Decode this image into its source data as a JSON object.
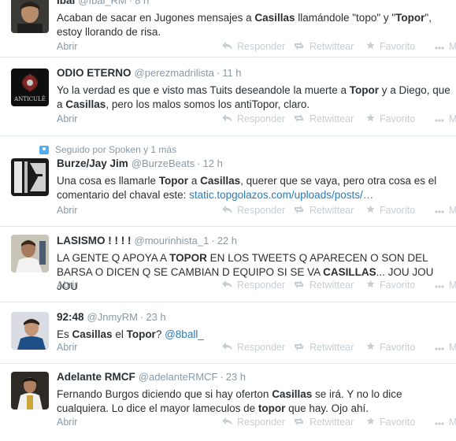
{
  "tweets": [
    {
      "fullname": "Ibai",
      "username": "@Ibai_RM",
      "time": "8 h",
      "text_parts": [
        {
          "t": "Acaban de sacar en Jugones mensajes a ",
          "b": false
        },
        {
          "t": "Casillas",
          "b": true
        },
        {
          "t": " llamándole \"topo\" y \"",
          "b": false
        },
        {
          "t": "Topor",
          "b": true
        },
        {
          "t": "\", estoy llorando de risa.",
          "b": false
        }
      ]
    },
    {
      "fullname": "ODIO ETERNO",
      "username": "@perezmadrilista",
      "time": "11 h",
      "avatar_caption": "ANTICULÉ",
      "text_parts": [
        {
          "t": "Yo la verdad es que e visto mas Tuits deseandole la muerte a ",
          "b": false
        },
        {
          "t": "Topor",
          "b": true
        },
        {
          "t": " y a Diego, que a ",
          "b": false
        },
        {
          "t": "Casillas",
          "b": true
        },
        {
          "t": ", pero los malos somos los antiTopor, claro.",
          "b": false
        }
      ]
    },
    {
      "context": "Seguido por Spoken y 1 más",
      "fullname": "Burze/Jay Jim",
      "username": "@BurzeBeats",
      "time": "12 h",
      "text_parts": [
        {
          "t": "Una cosa es llamarle ",
          "b": false
        },
        {
          "t": "Topor",
          "b": true
        },
        {
          "t": " a ",
          "b": false
        },
        {
          "t": "Casillas",
          "b": true
        },
        {
          "t": ", querer que se vaya, pero otra cosa es el comentario del chaval este: ",
          "b": false
        },
        {
          "t": "static.topgolazos.com/uploads/posts/…",
          "link": true
        }
      ]
    },
    {
      "fullname": "LASISMO ! ! ! !",
      "username": "@mourinhista_1",
      "time": "22 h",
      "text_parts": [
        {
          "t": "LA GENTE Q APOYA A ",
          "b": false
        },
        {
          "t": "TOPOR",
          "b": true
        },
        {
          "t": " EN LOS TWEETS Q APARECEN O SON DEL BARSA O DICEN Q SE CAMBIAN D EQUIPO SI SE VA ",
          "b": false
        },
        {
          "t": "CASILLAS",
          "b": true
        },
        {
          "t": "... JOU JOU JOU",
          "b": false
        }
      ]
    },
    {
      "fullname": "92:48",
      "username": "@JnmyRM",
      "time": "23 h",
      "text_parts": [
        {
          "t": "Es ",
          "b": false
        },
        {
          "t": "Casillas",
          "b": true
        },
        {
          "t": " el ",
          "b": false
        },
        {
          "t": "Topor",
          "b": true
        },
        {
          "t": "? ",
          "b": false
        },
        {
          "t": "@8ball_",
          "link": true
        }
      ]
    },
    {
      "fullname": "Adelante RMCF",
      "username": "@adelanteRMCF",
      "time": "23 h",
      "text_parts": [
        {
          "t": "Fernando Burgos diciendo que si hay oferton ",
          "b": false
        },
        {
          "t": "Casillas",
          "b": true
        },
        {
          "t": " se irá. Y no lo dice cualquiera. Lo dice el mayor lameculos de ",
          "b": false
        },
        {
          "t": "topor",
          "b": true
        },
        {
          "t": " que hay. Ojo ahí.",
          "b": false
        }
      ]
    }
  ],
  "actions": {
    "expand": "Abrir",
    "reply": "Responder",
    "retweet": "Retwittear",
    "favorite": "Favorito",
    "more": "Más"
  },
  "icons": {
    "reply": "reply-arrow-icon",
    "retweet": "retweet-icon",
    "favorite": "star-icon",
    "more": "ellipsis-icon",
    "context": "follow-context-icon"
  },
  "colors": {
    "text": "#292f33",
    "muted": "#8899a6",
    "action": "#c6ced4",
    "link": "#2b7bb9",
    "divider": "#e1e8ed"
  }
}
